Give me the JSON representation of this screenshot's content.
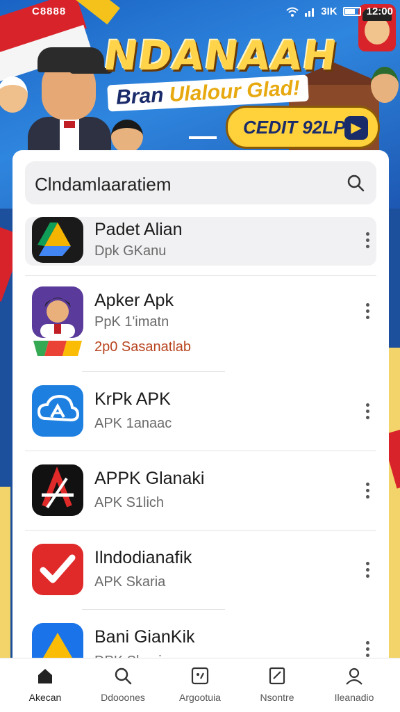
{
  "status_bar": {
    "carrier": "C8888",
    "signal_text": "3IK",
    "time": "12:00"
  },
  "banner": {
    "headline": "NDANAAH",
    "subline_part1": "Bran ",
    "subline_part2": "Ulalour Glad!",
    "cta_label": "CEDIT 92LP",
    "cta_arrow": "▶"
  },
  "search": {
    "query": "Clndamlaaratiem",
    "icon": "search-icon"
  },
  "apps": [
    {
      "title": "Padet Alian",
      "subtitle": "Dpk GKanu",
      "extra": "",
      "icon": "drive-triangle-icon",
      "selected": true
    },
    {
      "title": "Apker Apk",
      "subtitle": "PpK 1'imatn",
      "extra": "2p0 Sasanatlab",
      "icon": "portrait-icon",
      "selected": false
    },
    {
      "title": "KrPk APK",
      "subtitle": "APK 1anaac",
      "extra": "",
      "icon": "cloud-sync-icon",
      "selected": false
    },
    {
      "title": "APPK Glanaki",
      "subtitle": "APK S1lich",
      "extra": "",
      "icon": "letter-a-icon",
      "selected": false
    },
    {
      "title": "Ilndodianafik",
      "subtitle": "APK Skaria",
      "extra": "",
      "icon": "checkmark-icon",
      "selected": false
    },
    {
      "title": "Bani GianKik",
      "subtitle": "DPK Skania",
      "extra": "",
      "icon": "drive-triangle-icon",
      "selected": false
    }
  ],
  "bottom_nav": [
    {
      "label": "Akecan",
      "icon": "home-icon",
      "active": true
    },
    {
      "label": "Ddooones",
      "icon": "search-icon",
      "active": false
    },
    {
      "label": "Argootuia",
      "icon": "apps-icon",
      "active": false
    },
    {
      "label": "Nsontre",
      "icon": "edit-icon",
      "active": false
    },
    {
      "label": "Ileanadio",
      "icon": "profile-icon",
      "active": false
    }
  ],
  "colors": {
    "banner_blue": "#1a63c4",
    "accent_yellow": "#ffd13b",
    "flag_red": "#d8232a",
    "navy": "#1a2b6a"
  }
}
